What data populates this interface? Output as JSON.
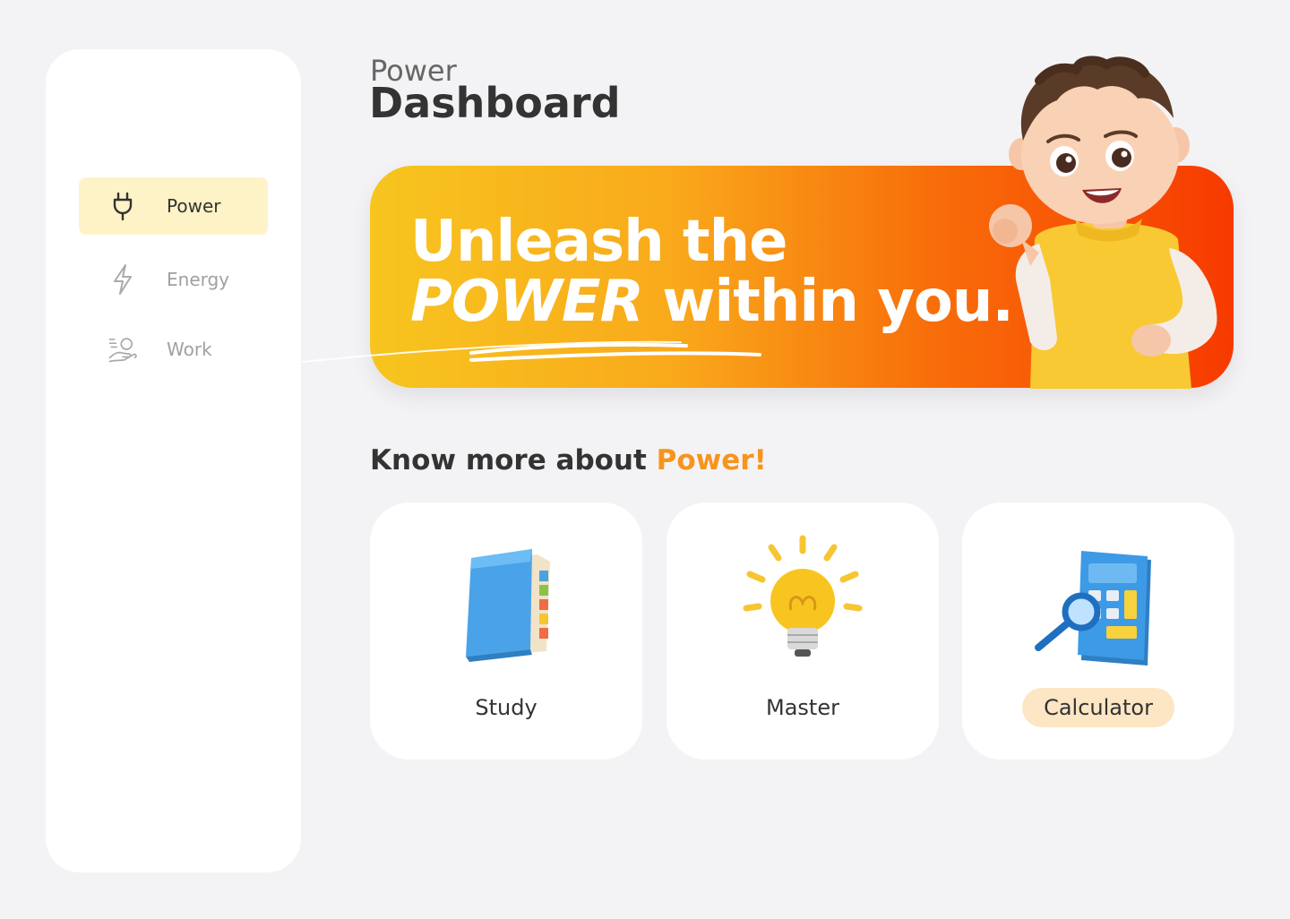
{
  "sidebar": {
    "items": [
      {
        "label": "Power",
        "icon": "plug-icon",
        "active": true
      },
      {
        "label": "Energy",
        "icon": "lightning-icon",
        "active": false
      },
      {
        "label": "Work",
        "icon": "work-icon",
        "active": false
      }
    ]
  },
  "header": {
    "subtitle": "Power",
    "title": "Dashboard"
  },
  "banner": {
    "line1": "Unleash the",
    "emphasis": "POWER",
    "line2_rest": " within you."
  },
  "section": {
    "heading_prefix": "Know more about ",
    "heading_accent": "Power!"
  },
  "cards": [
    {
      "label": "Study",
      "icon": "book-icon"
    },
    {
      "label": "Master",
      "icon": "lightbulb-icon"
    },
    {
      "label": "Calculator",
      "icon": "calculator-icon"
    }
  ],
  "colors": {
    "accent": "#f7941d",
    "active_nav_bg": "#fef3c7",
    "banner_start": "#f7c51f",
    "banner_end": "#f73a00"
  }
}
